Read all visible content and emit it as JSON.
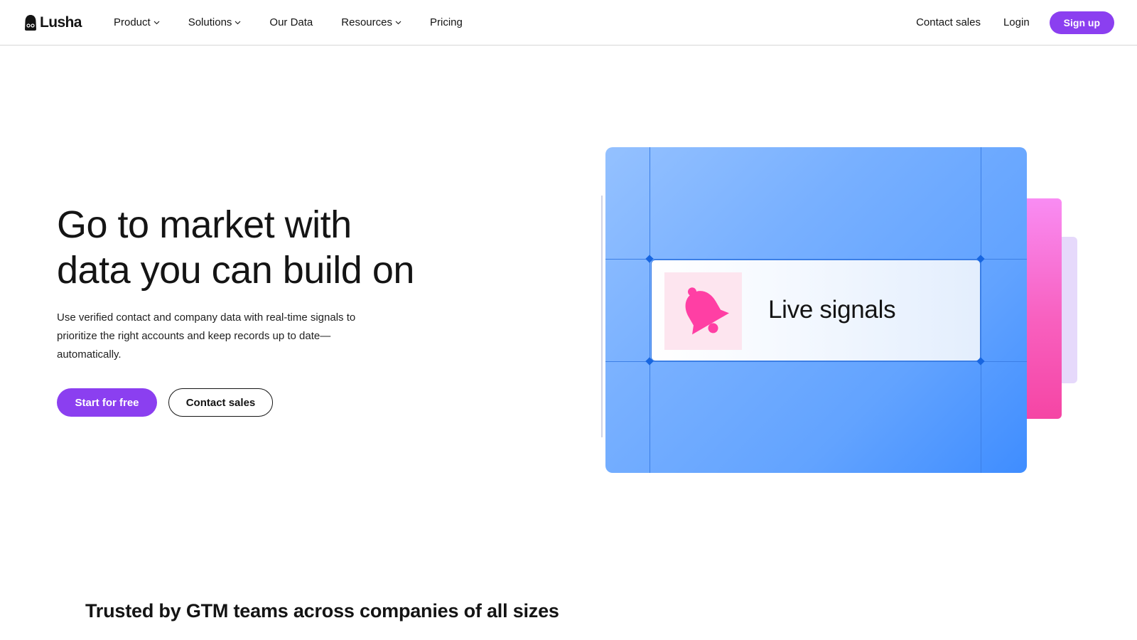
{
  "brand": {
    "name": "Lusha",
    "accent": "#8b3ff0"
  },
  "nav": {
    "items": [
      {
        "label": "Product",
        "has_dropdown": true
      },
      {
        "label": "Solutions",
        "has_dropdown": true
      },
      {
        "label": "Our Data",
        "has_dropdown": false
      },
      {
        "label": "Resources",
        "has_dropdown": true
      },
      {
        "label": "Pricing",
        "has_dropdown": false
      }
    ],
    "contact_sales": "Contact sales",
    "login": "Login",
    "signup": "Sign up"
  },
  "hero": {
    "title_line1": "Go to market with",
    "title_line2": "data you can build on",
    "subtitle": "Use verified contact and company data with real-time signals to prioritize the right accounts and keep records up to date—automatically.",
    "primary_cta": "Start for free",
    "secondary_cta": "Contact sales"
  },
  "illustration": {
    "signal_label": "Live signals",
    "icon": "bell-icon",
    "colors": {
      "card": "#62a3ff",
      "pink": "#f860bf",
      "lavender": "#e6d9fb",
      "bell": "#ff3fa4"
    }
  },
  "trusted": {
    "heading": "Trusted by GTM teams across companies of all sizes"
  }
}
